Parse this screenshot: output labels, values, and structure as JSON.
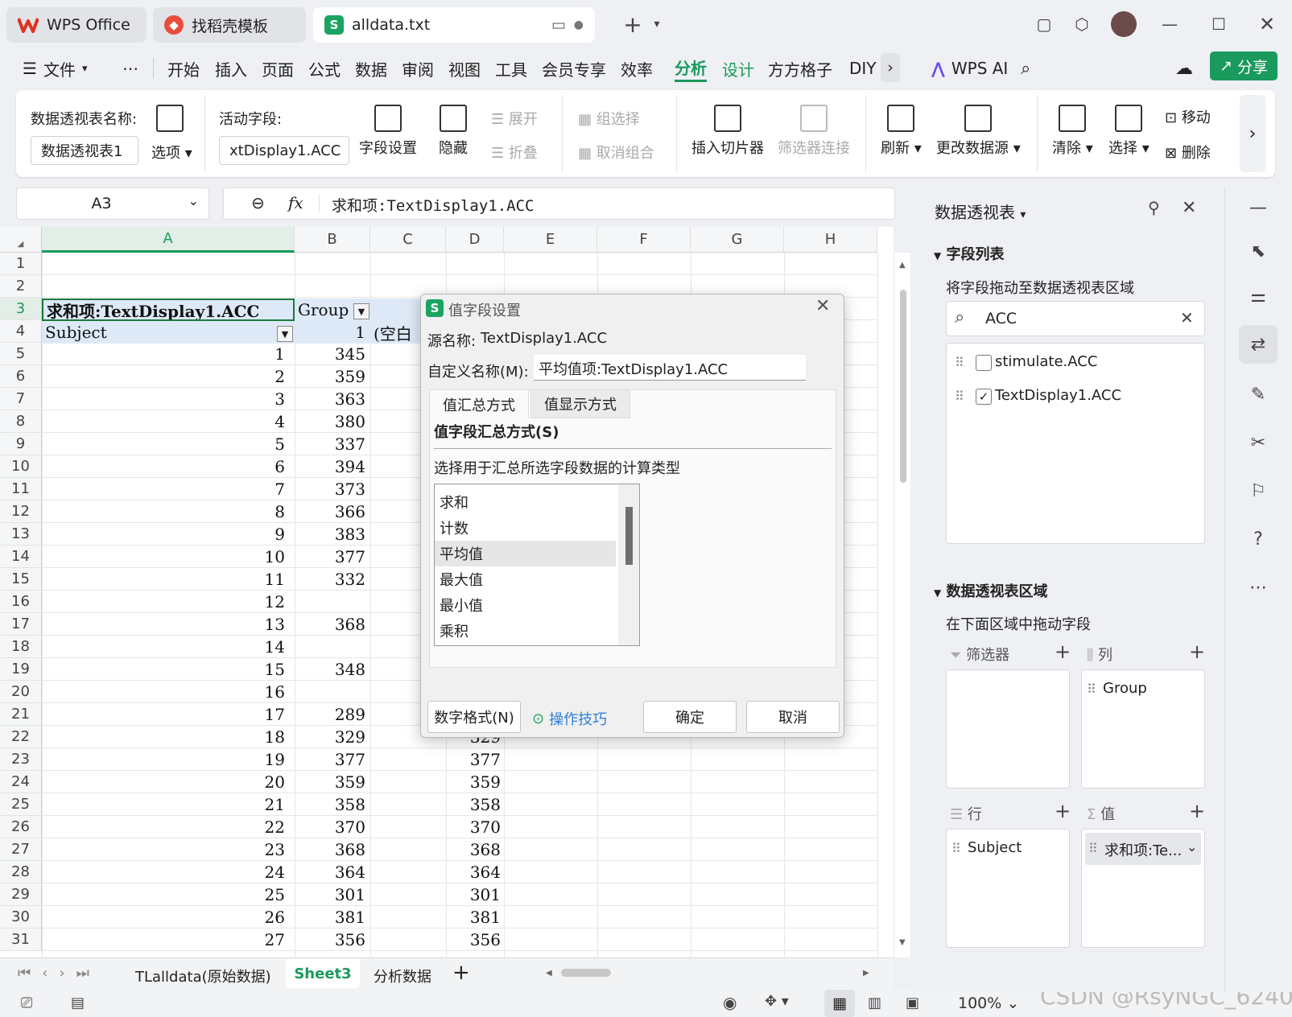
{
  "tabs": [
    {
      "label": "WPS Office",
      "icon": "wps-logo-icon",
      "color": "#e0311f"
    },
    {
      "label": "找稻壳模板",
      "icon": "docer-icon",
      "color": "#e84c3d"
    },
    {
      "label": "alldata.txt",
      "icon": "spreadsheet-icon",
      "color": "#1aa45f"
    }
  ],
  "menu": {
    "file": "文件",
    "more": "⋯",
    "items": [
      "开始",
      "插入",
      "页面",
      "公式",
      "数据",
      "审阅",
      "视图",
      "工具",
      "会员专享",
      "效率",
      "分析",
      "设计",
      "方方格子",
      "DIY"
    ],
    "active": "分析",
    "ai": "WPS AI",
    "share": "分享",
    "accent": "#1a9a5c"
  },
  "ribbon": {
    "pivot_name_label": "数据透视表名称:",
    "pivot_name_value": "数据透视表1",
    "options": "选项",
    "active_field_label": "活动字段:",
    "active_field_value": "xtDisplay1.ACC",
    "field_settings": "字段设置",
    "hide": "隐藏",
    "expand": "展开",
    "collapse": "折叠",
    "group_selection": "组选择",
    "ungroup": "取消组合",
    "insert_slicer": "插入切片器",
    "filter_connections": "筛选器连接",
    "refresh": "刷新",
    "change_source": "更改数据源",
    "clear": "清除",
    "select": "选择",
    "move": "移动",
    "delete": "删除"
  },
  "formula": {
    "cell_ref": "A3",
    "fx": "fx",
    "content": "求和项:TextDisplay1.ACC"
  },
  "grid": {
    "columns": [
      "A",
      "B",
      "C",
      "D",
      "E",
      "F",
      "G",
      "H"
    ],
    "header_a3": "求和项:TextDisplay1.ACC",
    "header_b3": "Group",
    "header_a4": "Subject",
    "header_b4": "1",
    "header_c4": "(空白",
    "rows": [
      {
        "n": "1"
      },
      {
        "n": "2"
      },
      {
        "n": "3"
      },
      {
        "n": "4"
      },
      {
        "n": "5",
        "a": "1",
        "b": "345",
        "d": ""
      },
      {
        "n": "6",
        "a": "2",
        "b": "359",
        "d": ""
      },
      {
        "n": "7",
        "a": "3",
        "b": "363",
        "d": ""
      },
      {
        "n": "8",
        "a": "4",
        "b": "380",
        "d": ""
      },
      {
        "n": "9",
        "a": "5",
        "b": "337",
        "d": ""
      },
      {
        "n": "10",
        "a": "6",
        "b": "394",
        "d": ""
      },
      {
        "n": "11",
        "a": "7",
        "b": "373",
        "d": ""
      },
      {
        "n": "12",
        "a": "8",
        "b": "366",
        "d": ""
      },
      {
        "n": "13",
        "a": "9",
        "b": "383",
        "d": ""
      },
      {
        "n": "14",
        "a": "10",
        "b": "377",
        "d": ""
      },
      {
        "n": "15",
        "a": "11",
        "b": "332",
        "d": ""
      },
      {
        "n": "16",
        "a": "12",
        "b": "",
        "d": ""
      },
      {
        "n": "17",
        "a": "13",
        "b": "368",
        "d": ""
      },
      {
        "n": "18",
        "a": "14",
        "b": "",
        "d": ""
      },
      {
        "n": "19",
        "a": "15",
        "b": "348",
        "d": ""
      },
      {
        "n": "20",
        "a": "16",
        "b": "",
        "d": ""
      },
      {
        "n": "21",
        "a": "17",
        "b": "289",
        "d": ""
      },
      {
        "n": "22",
        "a": "18",
        "b": "329",
        "d": "329"
      },
      {
        "n": "23",
        "a": "19",
        "b": "377",
        "d": "377"
      },
      {
        "n": "24",
        "a": "20",
        "b": "359",
        "d": "359"
      },
      {
        "n": "25",
        "a": "21",
        "b": "358",
        "d": "358"
      },
      {
        "n": "26",
        "a": "22",
        "b": "370",
        "d": "370"
      },
      {
        "n": "27",
        "a": "23",
        "b": "368",
        "d": "368"
      },
      {
        "n": "28",
        "a": "24",
        "b": "364",
        "d": "364"
      },
      {
        "n": "29",
        "a": "25",
        "b": "301",
        "d": "301"
      },
      {
        "n": "30",
        "a": "26",
        "b": "381",
        "d": "381"
      },
      {
        "n": "31",
        "a": "27",
        "b": "356",
        "d": "356"
      }
    ]
  },
  "sheets": [
    "TLalldata(原始数据)",
    "Sheet3",
    "分析数据"
  ],
  "active_sheet": "Sheet3",
  "dialog": {
    "title": "值字段设置",
    "source_label": "源名称:",
    "source_value": "TextDisplay1.ACC",
    "custom_label": "自定义名称(M):",
    "custom_value": "平均值项:TextDisplay1.ACC",
    "tab1": "值汇总方式",
    "tab2": "值显示方式",
    "section": "值字段汇总方式(S)",
    "hint": "选择用于汇总所选字段数据的计算类型",
    "options": [
      "求和",
      "计数",
      "平均值",
      "最大值",
      "最小值",
      "乘积"
    ],
    "selected": "平均值",
    "number_format": "数字格式(N)",
    "tips": "操作技巧",
    "ok": "确定",
    "cancel": "取消"
  },
  "panel": {
    "title": "数据透视表",
    "field_list": "字段列表",
    "drag_hint": "将字段拖动至数据透视表区域",
    "search_value": "ACC",
    "fields": [
      {
        "name": "stimulate.ACC",
        "checked": false
      },
      {
        "name": "TextDisplay1.ACC",
        "checked": true
      }
    ],
    "area_title": "数据透视表区域",
    "area_hint": "在下面区域中拖动字段",
    "filters": "筛选器",
    "columns": "列",
    "rows": "行",
    "values": "值",
    "col_field": "Group",
    "row_field": "Subject",
    "value_field": "求和项:Te..."
  },
  "status": {
    "zoom": "100%",
    "watermark": "CSDN @RsyNGC_6240"
  }
}
